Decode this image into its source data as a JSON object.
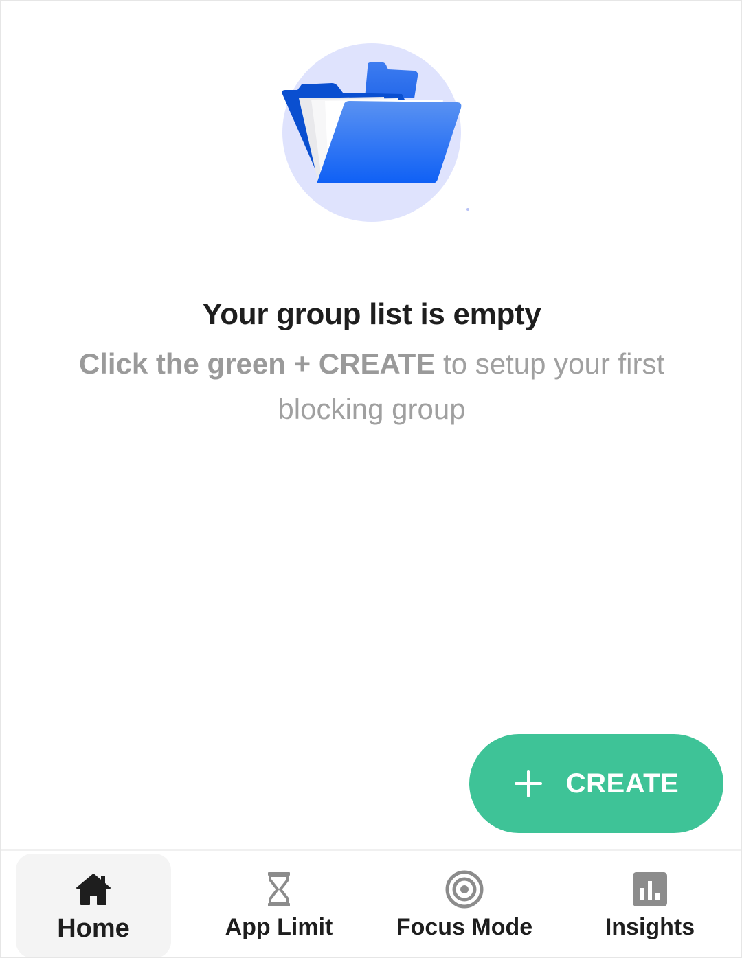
{
  "empty_state": {
    "title": "Your group list is empty",
    "desc_bold": "Click the green + CREATE",
    "desc_rest": " to setup your first blocking group"
  },
  "fab": {
    "label": "CREATE",
    "icon": "plus-icon",
    "color": "#3ec397"
  },
  "bottom_nav": {
    "items": [
      {
        "label": "Home",
        "icon": "home-icon",
        "active": true
      },
      {
        "label": "App Limit",
        "icon": "hourglass-icon",
        "active": false
      },
      {
        "label": "Focus Mode",
        "icon": "target-icon",
        "active": false
      },
      {
        "label": "Insights",
        "icon": "bar-chart-icon",
        "active": false
      }
    ]
  },
  "colors": {
    "accent_green": "#3ec397",
    "folder_blue": "#1a66f0",
    "circle_bg": "#dfe3fd"
  }
}
